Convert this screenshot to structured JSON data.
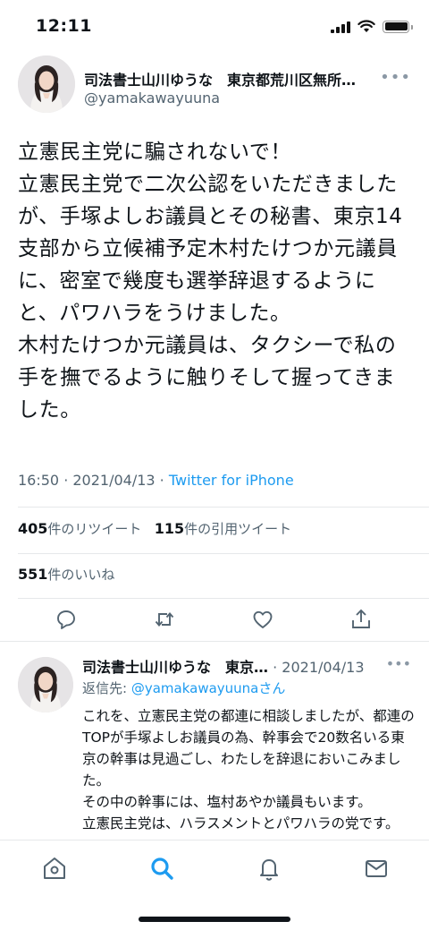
{
  "status_bar": {
    "time": "12:11"
  },
  "tweet": {
    "author_name": "司法書士山川ゆうな　東京都荒川区無所…",
    "handle": "@yamakawayuuna",
    "text": "立憲民主党に騙されないで！\n立憲民主党で二次公認をいただきましたが、手塚よしお議員とその秘書、東京14支部から立候補予定木村たけつか元議員に、密室で幾度も選挙辞退するようにと、パワハラをうけました。\n木村たけつか元議員は、タクシーで私の手を撫でるように触りそして握ってきました。",
    "time": "16:50",
    "separator": " · ",
    "date": "2021/04/13",
    "source": "Twitter for iPhone",
    "retweets_count": "405",
    "retweets_label": "件のリツイート",
    "quotes_count": "115",
    "quotes_label": "件の引用ツイート",
    "likes_count": "551",
    "likes_label": "件のいいね"
  },
  "reply": {
    "author_name": "司法書士山川ゆうな　東京…",
    "date": " · 2021/04/13",
    "reply_to_label": "返信先: ",
    "reply_to_handle": "@yamakawayuuna",
    "reply_to_suffix": "さん",
    "text": "これを、立憲民主党の都連に相談しましたが、都連のTOPが手塚よしお議員の為、幹事会で20数名いる東京の幹事は見過ごし、わたしを辞退においこみました。\nその中の幹事には、塩村あやか議員もいます。\n立憲民主党は、ハラスメントとパワハラの党です。"
  },
  "icons": {
    "more": "more-icon",
    "reply": "reply-icon",
    "retweet": "retweet-icon",
    "like": "heart-icon",
    "share": "share-icon",
    "home": "home-icon",
    "search": "search-icon",
    "notifications": "bell-icon",
    "messages": "envelope-icon"
  },
  "colors": {
    "accent": "#1d9bf0",
    "text": "#0f1419",
    "muted": "#536471"
  }
}
